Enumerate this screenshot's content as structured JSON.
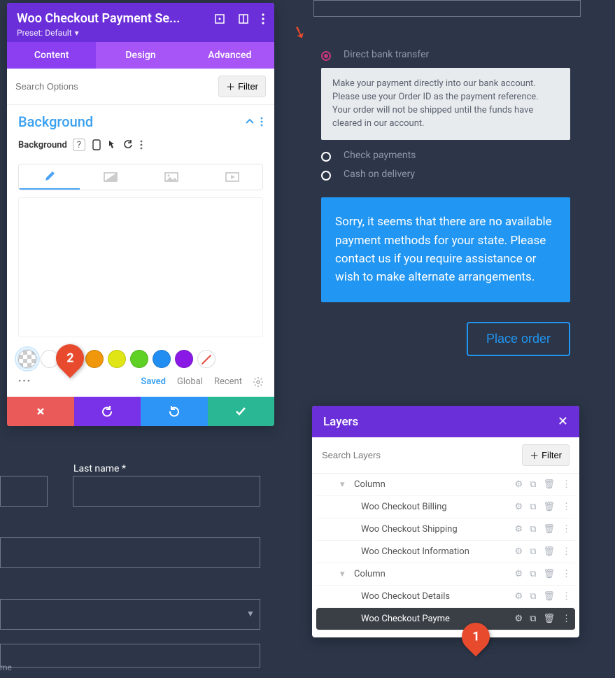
{
  "settings": {
    "title": "Woo Checkout Payment Se...",
    "preset": "Preset: Default",
    "tabs": [
      "Content",
      "Design",
      "Advanced"
    ],
    "active_tab": 0,
    "search_placeholder": "Search Options",
    "filter_label": "Filter",
    "section_title": "Background",
    "row_label": "Background",
    "footer": {
      "saved": "Saved",
      "global": "Global",
      "recent": "Recent"
    },
    "swatches": [
      {
        "type": "checker"
      },
      {
        "type": "color",
        "color": "#ffffff"
      },
      {
        "type": "color",
        "color": "#ed3a28"
      },
      {
        "type": "color",
        "color": "#f0970b"
      },
      {
        "type": "color",
        "color": "#e0e616"
      },
      {
        "type": "color",
        "color": "#5fd124"
      },
      {
        "type": "color",
        "color": "#238ef2"
      },
      {
        "type": "color",
        "color": "#8a19e6"
      },
      {
        "type": "nopick"
      }
    ],
    "actions": {
      "cancel_color": "#e95a58",
      "undo_color": "#7a32e8",
      "redo_color": "#2d95f5",
      "confirm_color": "#2ab793"
    }
  },
  "callouts": {
    "badge1": "1",
    "badge2": "2"
  },
  "checkout": {
    "methods": [
      {
        "id": "bank",
        "label": "Direct bank transfer",
        "selected": true
      },
      {
        "id": "check",
        "label": "Check payments",
        "selected": false
      },
      {
        "id": "cod",
        "label": "Cash on delivery",
        "selected": false
      }
    ],
    "bank_desc": "Make your payment directly into our bank account. Please use your Order ID as the payment reference. Your order will not be shipped until the funds have cleared in our account.",
    "notice": "Sorry, it seems that there are no available payment methods for your state. Please contact us if you require assistance or wish to make alternate arrangements.",
    "place_order_label": "Place order"
  },
  "form": {
    "last_name_label": "Last name *",
    "tiny_label": "me"
  },
  "layers": {
    "title": "Layers",
    "search_placeholder": "Search Layers",
    "filter_label": "Filter",
    "rows": [
      {
        "label": "Column",
        "indent": 1,
        "collapsible": true,
        "selected": false
      },
      {
        "label": "Woo Checkout Billing",
        "indent": 2,
        "selected": false
      },
      {
        "label": "Woo Checkout Shipping",
        "indent": 2,
        "selected": false
      },
      {
        "label": "Woo Checkout Information",
        "indent": 2,
        "selected": false
      },
      {
        "label": "Column",
        "indent": 1,
        "collapsible": true,
        "selected": false
      },
      {
        "label": "Woo Checkout Details",
        "indent": 2,
        "selected": false
      },
      {
        "label": "Woo Checkout Payme",
        "indent": 2,
        "selected": true
      }
    ]
  }
}
